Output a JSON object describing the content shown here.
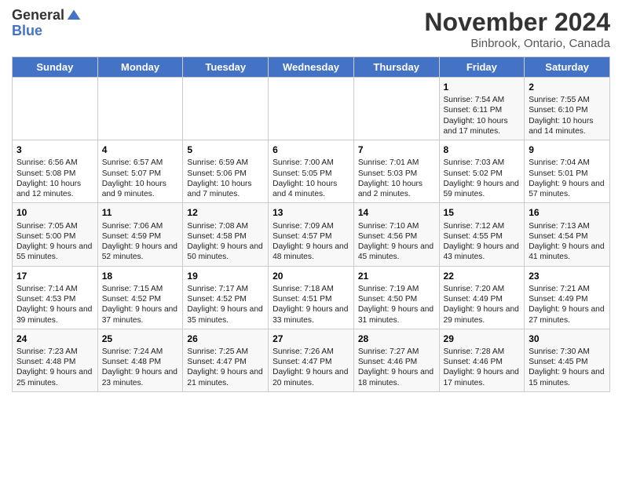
{
  "logo": {
    "general": "General",
    "blue": "Blue"
  },
  "title": "November 2024",
  "location": "Binbrook, Ontario, Canada",
  "days_of_week": [
    "Sunday",
    "Monday",
    "Tuesday",
    "Wednesday",
    "Thursday",
    "Friday",
    "Saturday"
  ],
  "weeks": [
    [
      {
        "day": "",
        "info": ""
      },
      {
        "day": "",
        "info": ""
      },
      {
        "day": "",
        "info": ""
      },
      {
        "day": "",
        "info": ""
      },
      {
        "day": "",
        "info": ""
      },
      {
        "day": "1",
        "info": "Sunrise: 7:54 AM\nSunset: 6:11 PM\nDaylight: 10 hours and 17 minutes."
      },
      {
        "day": "2",
        "info": "Sunrise: 7:55 AM\nSunset: 6:10 PM\nDaylight: 10 hours and 14 minutes."
      }
    ],
    [
      {
        "day": "3",
        "info": "Sunrise: 6:56 AM\nSunset: 5:08 PM\nDaylight: 10 hours and 12 minutes."
      },
      {
        "day": "4",
        "info": "Sunrise: 6:57 AM\nSunset: 5:07 PM\nDaylight: 10 hours and 9 minutes."
      },
      {
        "day": "5",
        "info": "Sunrise: 6:59 AM\nSunset: 5:06 PM\nDaylight: 10 hours and 7 minutes."
      },
      {
        "day": "6",
        "info": "Sunrise: 7:00 AM\nSunset: 5:05 PM\nDaylight: 10 hours and 4 minutes."
      },
      {
        "day": "7",
        "info": "Sunrise: 7:01 AM\nSunset: 5:03 PM\nDaylight: 10 hours and 2 minutes."
      },
      {
        "day": "8",
        "info": "Sunrise: 7:03 AM\nSunset: 5:02 PM\nDaylight: 9 hours and 59 minutes."
      },
      {
        "day": "9",
        "info": "Sunrise: 7:04 AM\nSunset: 5:01 PM\nDaylight: 9 hours and 57 minutes."
      }
    ],
    [
      {
        "day": "10",
        "info": "Sunrise: 7:05 AM\nSunset: 5:00 PM\nDaylight: 9 hours and 55 minutes."
      },
      {
        "day": "11",
        "info": "Sunrise: 7:06 AM\nSunset: 4:59 PM\nDaylight: 9 hours and 52 minutes."
      },
      {
        "day": "12",
        "info": "Sunrise: 7:08 AM\nSunset: 4:58 PM\nDaylight: 9 hours and 50 minutes."
      },
      {
        "day": "13",
        "info": "Sunrise: 7:09 AM\nSunset: 4:57 PM\nDaylight: 9 hours and 48 minutes."
      },
      {
        "day": "14",
        "info": "Sunrise: 7:10 AM\nSunset: 4:56 PM\nDaylight: 9 hours and 45 minutes."
      },
      {
        "day": "15",
        "info": "Sunrise: 7:12 AM\nSunset: 4:55 PM\nDaylight: 9 hours and 43 minutes."
      },
      {
        "day": "16",
        "info": "Sunrise: 7:13 AM\nSunset: 4:54 PM\nDaylight: 9 hours and 41 minutes."
      }
    ],
    [
      {
        "day": "17",
        "info": "Sunrise: 7:14 AM\nSunset: 4:53 PM\nDaylight: 9 hours and 39 minutes."
      },
      {
        "day": "18",
        "info": "Sunrise: 7:15 AM\nSunset: 4:52 PM\nDaylight: 9 hours and 37 minutes."
      },
      {
        "day": "19",
        "info": "Sunrise: 7:17 AM\nSunset: 4:52 PM\nDaylight: 9 hours and 35 minutes."
      },
      {
        "day": "20",
        "info": "Sunrise: 7:18 AM\nSunset: 4:51 PM\nDaylight: 9 hours and 33 minutes."
      },
      {
        "day": "21",
        "info": "Sunrise: 7:19 AM\nSunset: 4:50 PM\nDaylight: 9 hours and 31 minutes."
      },
      {
        "day": "22",
        "info": "Sunrise: 7:20 AM\nSunset: 4:49 PM\nDaylight: 9 hours and 29 minutes."
      },
      {
        "day": "23",
        "info": "Sunrise: 7:21 AM\nSunset: 4:49 PM\nDaylight: 9 hours and 27 minutes."
      }
    ],
    [
      {
        "day": "24",
        "info": "Sunrise: 7:23 AM\nSunset: 4:48 PM\nDaylight: 9 hours and 25 minutes."
      },
      {
        "day": "25",
        "info": "Sunrise: 7:24 AM\nSunset: 4:48 PM\nDaylight: 9 hours and 23 minutes."
      },
      {
        "day": "26",
        "info": "Sunrise: 7:25 AM\nSunset: 4:47 PM\nDaylight: 9 hours and 21 minutes."
      },
      {
        "day": "27",
        "info": "Sunrise: 7:26 AM\nSunset: 4:47 PM\nDaylight: 9 hours and 20 minutes."
      },
      {
        "day": "28",
        "info": "Sunrise: 7:27 AM\nSunset: 4:46 PM\nDaylight: 9 hours and 18 minutes."
      },
      {
        "day": "29",
        "info": "Sunrise: 7:28 AM\nSunset: 4:46 PM\nDaylight: 9 hours and 17 minutes."
      },
      {
        "day": "30",
        "info": "Sunrise: 7:30 AM\nSunset: 4:45 PM\nDaylight: 9 hours and 15 minutes."
      }
    ]
  ]
}
